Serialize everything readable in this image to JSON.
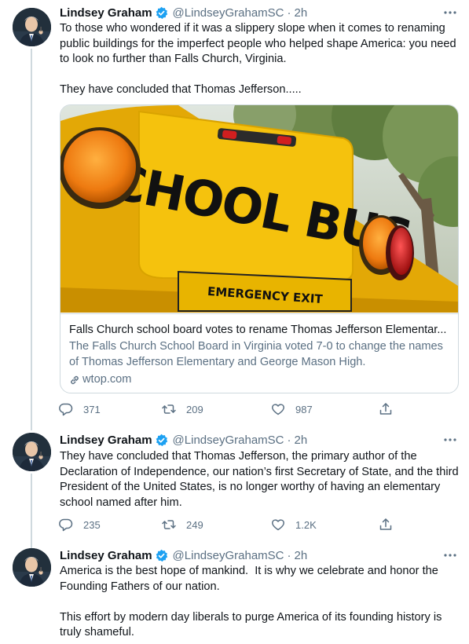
{
  "author": {
    "name": "Lindsey Graham",
    "handle": "@LindseyGrahamSC",
    "separator": "·",
    "verified_icon": "verified-badge-icon",
    "accent": "#1da1f2"
  },
  "tweets": [
    {
      "time": "2h",
      "paragraphs": [
        "To those who wondered if it was a slippery slope when it comes to renaming public buildings for the imperfect people who helped shape America: you need to look no further than Falls Church, Virginia.",
        "They have concluded that Thomas Jefferson....."
      ],
      "card": {
        "title": "Falls Church school board votes to rename Thomas Jefferson Elementar...",
        "description": "The Falls Church School Board in Virginia voted 7-0 to change the names of Thomas Jefferson Elementary and George Mason High.",
        "domain": "wtop.com",
        "image_text_main": "SCHOOL BUS",
        "image_text_sub": "EMERGENCY EXIT"
      },
      "stats": {
        "replies": "371",
        "retweets": "209",
        "likes": "987"
      }
    },
    {
      "time": "2h",
      "paragraphs": [
        "They have concluded that Thomas Jefferson, the primary author of the Declaration of Independence, our nation’s first Secretary of State, and the third President of the United States, is no longer worthy of having an elementary school named after him."
      ],
      "stats": {
        "replies": "235",
        "retweets": "249",
        "likes": "1.2K"
      }
    },
    {
      "time": "2h",
      "paragraphs": [
        "America is the best hope of mankind.  It is why we celebrate and honor the Founding Fathers of our nation.",
        "This effort by modern day liberals to purge America of its founding history is truly shameful."
      ]
    }
  ],
  "icons": {
    "more": "more-dots-icon",
    "reply": "reply-icon",
    "retweet": "retweet-icon",
    "like": "like-icon",
    "share": "share-icon",
    "link": "link-icon"
  },
  "colors": {
    "text": "#0f1419",
    "secondary": "#5b7083",
    "border": "#cfd9de",
    "bus_yellow": "#f2b705"
  }
}
